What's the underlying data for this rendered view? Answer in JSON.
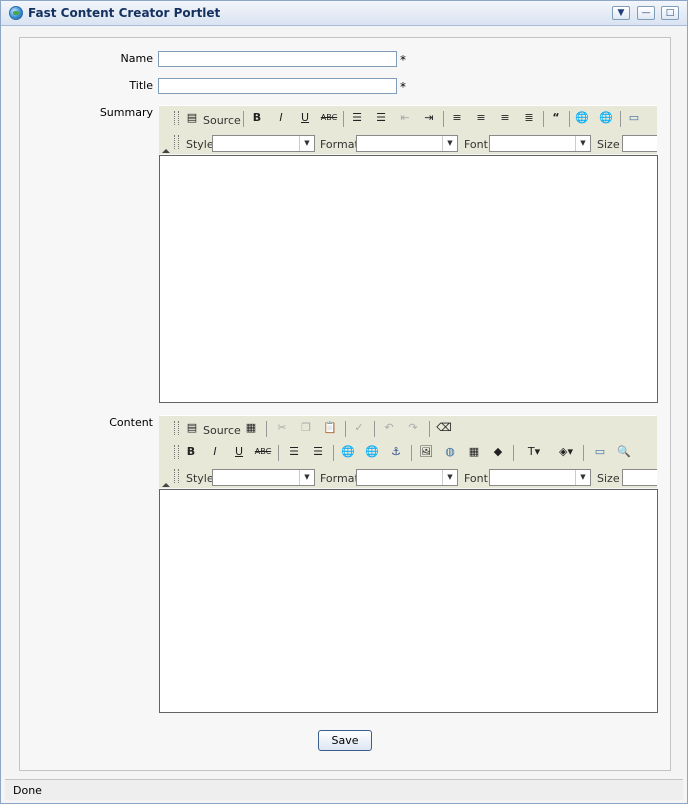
{
  "window": {
    "title": "Fast Content Creator Portlet",
    "btn_menu": "▼",
    "btn_min": "—",
    "btn_max": "□"
  },
  "form": {
    "name_label": "Name",
    "name_value": "",
    "title_label": "Title",
    "title_value": "",
    "required_mark": "*",
    "summary_label": "Summary",
    "content_label": "Content",
    "save_label": "Save"
  },
  "editor": {
    "source_label": "Source",
    "style_label": "Style",
    "format_label": "Format",
    "font_label": "Font",
    "size_label": "Size"
  },
  "status": {
    "text": "Done"
  }
}
